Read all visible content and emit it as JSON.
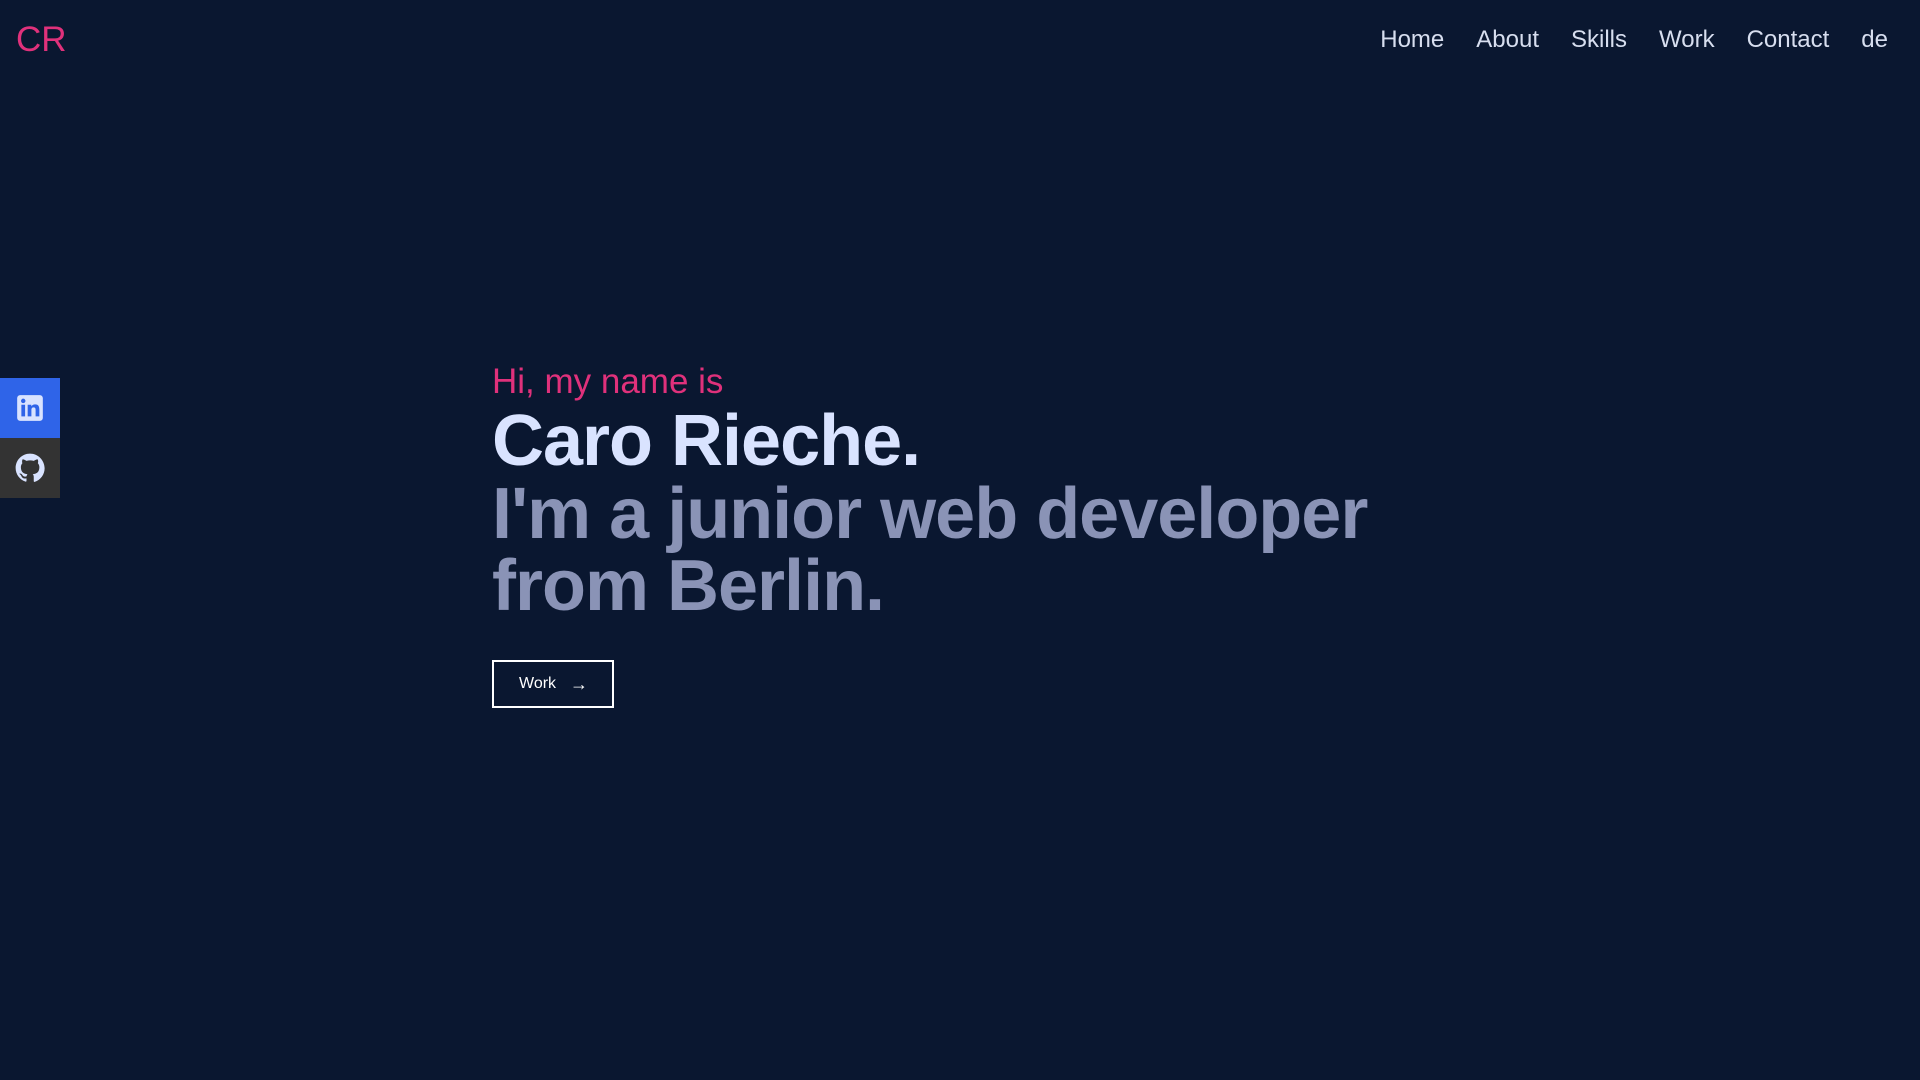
{
  "header": {
    "logo": "CR",
    "nav": [
      {
        "label": "Home"
      },
      {
        "label": "About"
      },
      {
        "label": "Skills"
      },
      {
        "label": "Work"
      },
      {
        "label": "Contact"
      },
      {
        "label": "de"
      }
    ]
  },
  "social": {
    "items": [
      {
        "icon": "linkedin-icon",
        "color": "#2f64e8"
      },
      {
        "icon": "github-icon",
        "color": "#333333"
      }
    ]
  },
  "hero": {
    "greeting": "Hi, my name is",
    "name": "Caro Rieche.",
    "tagline_line1": "I'm a junior web developer",
    "tagline_line2": "from Berlin.",
    "cta_label": "Work",
    "cta_arrow": "→"
  },
  "colors": {
    "background": "#0a1730",
    "accent": "#e0317b",
    "name": "#d9e3ff",
    "tagline": "#8a93b6",
    "nav_text": "#d7deef"
  }
}
